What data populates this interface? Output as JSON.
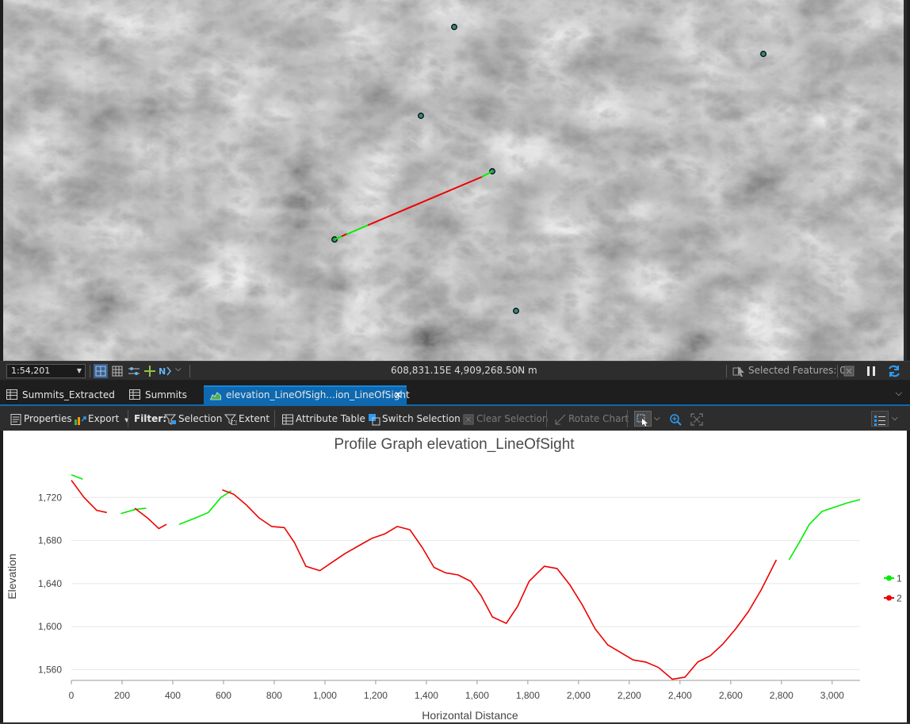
{
  "map": {
    "summits": [
      "summit-1",
      "summit-2",
      "summit-3",
      "summit-4",
      "summit-5",
      "summit-6"
    ],
    "sight_line": {
      "visible_color": "#00ee00",
      "hidden_color": "#ee0000"
    }
  },
  "statusbar": {
    "scale": "1:54,201",
    "coordinates": "608,831.15E 4,909,268.50N m",
    "selected_features": "Selected Features: 0"
  },
  "tabs": [
    {
      "label": "Summits_Extracted"
    },
    {
      "label": "Summits"
    },
    {
      "label": "elevation_LineOfSigh...ion_LineOfSight",
      "active": true
    }
  ],
  "toolbar": {
    "properties": "Properties",
    "export": "Export",
    "filter": "Filter:",
    "selection": "Selection",
    "extent": "Extent",
    "attribute_table": "Attribute Table",
    "switch_selection": "Switch Selection",
    "clear_selection": "Clear Selection",
    "rotate_chart": "Rotate Chart"
  },
  "colors": {
    "accent": "#0e69b0",
    "visible": "#00ee00",
    "not_visible": "#ee0000"
  },
  "chart_data": {
    "type": "line",
    "title": "Profile Graph elevation_LineOfSight",
    "xlabel": "Horizontal Distance",
    "ylabel": "Elevation",
    "xlim": [
      0,
      3110
    ],
    "ylim": [
      1550,
      1760
    ],
    "xticks": [
      0,
      200,
      400,
      600,
      800,
      1000,
      1200,
      1400,
      1600,
      1800,
      2000,
      2200,
      2400,
      2600,
      2800,
      3000
    ],
    "xtick_labels": [
      "0",
      "200",
      "400",
      "600",
      "800",
      "1,000",
      "1,200",
      "1,400",
      "1,600",
      "1,800",
      "2,000",
      "2,200",
      "2,400",
      "2,600",
      "2,800",
      "3,000"
    ],
    "yticks": [
      1560,
      1600,
      1640,
      1680,
      1720
    ],
    "ytick_labels": [
      "1,560",
      "1,600",
      "1,640",
      "1,680",
      "1,720"
    ],
    "grid": true,
    "legend": "right",
    "series": [
      {
        "name": "1",
        "color": "#00ee00",
        "segments": [
          [
            [
              0,
              1741
            ],
            [
              45,
              1737
            ]
          ],
          [
            [
              195,
              1705
            ],
            [
              255,
              1709
            ],
            [
              295,
              1710
            ]
          ],
          [
            [
              425,
              1695
            ],
            [
              480,
              1700
            ],
            [
              540,
              1706
            ],
            [
              590,
              1720
            ],
            [
              630,
              1726
            ]
          ],
          [
            [
              2830,
              1662
            ],
            [
              2870,
              1678
            ],
            [
              2910,
              1695
            ],
            [
              2960,
              1707
            ],
            [
              3010,
              1711
            ],
            [
              3060,
              1715
            ],
            [
              3110,
              1718
            ]
          ]
        ]
      },
      {
        "name": "2",
        "color": "#ee0000",
        "segments": [
          [
            [
              0,
              1736
            ],
            [
              50,
              1720
            ],
            [
              100,
              1708
            ],
            [
              140,
              1706
            ]
          ],
          [
            [
              250,
              1710
            ],
            [
              300,
              1701
            ],
            [
              345,
              1691
            ],
            [
              375,
              1695
            ]
          ],
          [
            [
              595,
              1727
            ],
            [
              640,
              1723
            ],
            [
              690,
              1713
            ],
            [
              740,
              1701
            ],
            [
              790,
              1693
            ],
            [
              840,
              1692
            ],
            [
              880,
              1678
            ],
            [
              925,
              1656
            ],
            [
              980,
              1652
            ],
            [
              1030,
              1660
            ],
            [
              1080,
              1668
            ],
            [
              1140,
              1676
            ],
            [
              1185,
              1682
            ],
            [
              1235,
              1686
            ],
            [
              1285,
              1693
            ],
            [
              1335,
              1690
            ],
            [
              1385,
              1673
            ],
            [
              1430,
              1655
            ],
            [
              1475,
              1650
            ],
            [
              1525,
              1648
            ],
            [
              1575,
              1642
            ],
            [
              1615,
              1629
            ],
            [
              1660,
              1609
            ],
            [
              1715,
              1603
            ],
            [
              1760,
              1619
            ],
            [
              1805,
              1642
            ],
            [
              1865,
              1656
            ],
            [
              1915,
              1654
            ],
            [
              1965,
              1639
            ],
            [
              2015,
              1620
            ],
            [
              2065,
              1598
            ],
            [
              2115,
              1583
            ],
            [
              2165,
              1576
            ],
            [
              2215,
              1569
            ],
            [
              2265,
              1567
            ],
            [
              2315,
              1562
            ],
            [
              2370,
              1551
            ],
            [
              2420,
              1553
            ],
            [
              2470,
              1567
            ],
            [
              2520,
              1573
            ],
            [
              2570,
              1584
            ],
            [
              2620,
              1598
            ],
            [
              2670,
              1614
            ],
            [
              2720,
              1634
            ],
            [
              2780,
              1662
            ]
          ]
        ]
      }
    ]
  }
}
